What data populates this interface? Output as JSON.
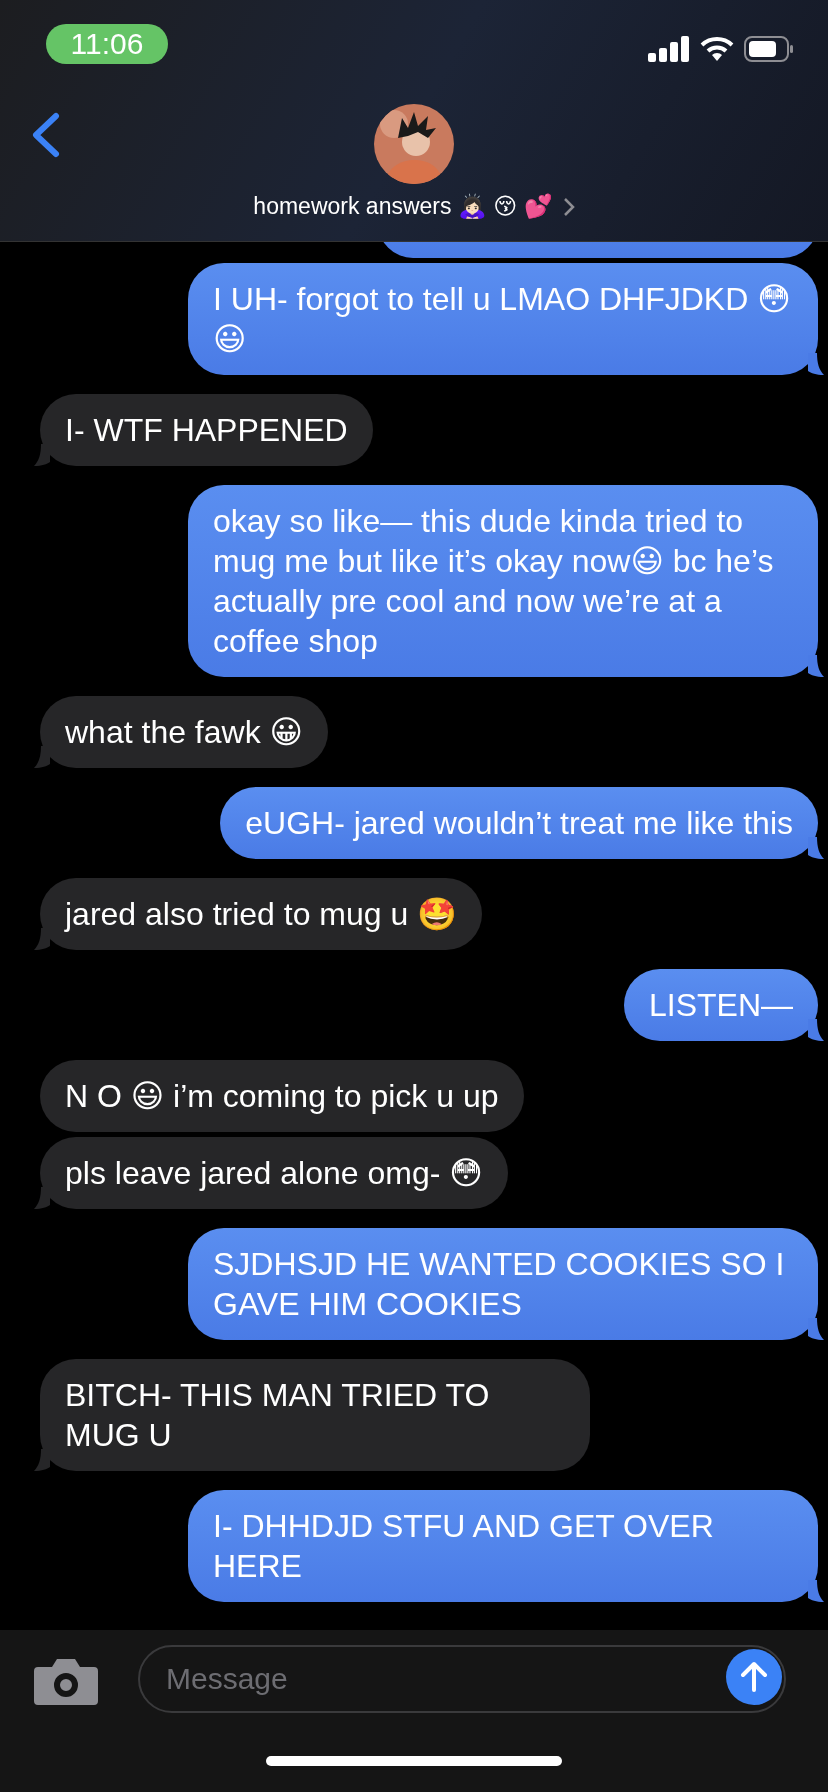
{
  "status_bar": {
    "time": "11:06"
  },
  "contact": {
    "name": "homework answers 🙇🏻‍♀️ 😚 💕"
  },
  "messages": [
    {
      "kind": "sent",
      "tail": false
    },
    {
      "kind": "sent",
      "text": "I UH- forgot to tell u LMAO DHFJDKD 😳 😃",
      "tail": true
    },
    {
      "kind": "received",
      "text": "I- WTF HAPPENED",
      "tail": true
    },
    {
      "kind": "sent",
      "text": "okay so like— this dude kinda tried to mug me but like it’s okay now😃 bc he’s actually pre cool and now we’re at a coffee shop",
      "tail": true
    },
    {
      "kind": "received",
      "text": "what the fawk 😀",
      "tail": true
    },
    {
      "kind": "sent",
      "text": "eUGH- jared wouldn’t treat me like this",
      "tail": true
    },
    {
      "kind": "received",
      "text": "jared also tried to mug u 🤩",
      "tail": true
    },
    {
      "kind": "sent",
      "text": "LISTEN—",
      "tail": true
    },
    {
      "kind": "received",
      "text": "N O 😃 i’m coming to pick u up",
      "tail": false
    },
    {
      "kind": "received",
      "text": "pls leave jared alone omg- 😳",
      "tail": true
    },
    {
      "kind": "sent",
      "text": "SJDHSJD HE WANTED COOKIES SO I GAVE HIM COOKIES",
      "tail": true
    },
    {
      "kind": "received",
      "text": "BITCH- THIS MAN TRIED TO MUG U",
      "tail": true
    },
    {
      "kind": "sent",
      "text": "I- DHHDJD STFU AND GET OVER HERE",
      "tail": true
    }
  ],
  "composer": {
    "placeholder": "Message"
  }
}
